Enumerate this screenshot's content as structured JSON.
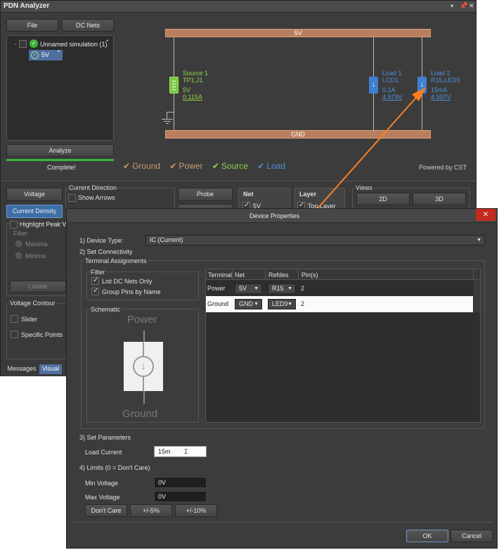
{
  "pdn": {
    "title": "PDN Analyzer",
    "file_btn": "File",
    "dcnets_btn": "DC Nets",
    "tree_root": "Unnamed simulation (1)",
    "tree_root_mark": "*",
    "tree_child": "5V",
    "tree_child_mark": "*",
    "analyze_btn": "Analyze",
    "status": "Complete!",
    "rail_top": "5V",
    "rail_bottom": "GND",
    "source": {
      "name": "Source 1",
      "ref": "TP1,J1",
      "voltage": "5V",
      "current": "0.115A"
    },
    "load1": {
      "name": "Load 1",
      "ref": "LCD1",
      "current": "0.1A",
      "voltage": "4.979V"
    },
    "load2": {
      "name": "Load 2",
      "ref": "R15,LED9",
      "current": "15mA",
      "voltage": "4.997V"
    },
    "legend": {
      "ground": "Ground",
      "power": "Power",
      "source": "Source",
      "load": "Load"
    },
    "powered_by": "Powered by CST",
    "voltage_btn": "Voltage",
    "current_density_btn": "Current Density",
    "current_direction_title": "Current Direction",
    "show_arrows": "Show Arrows",
    "probe_btn": "Probe",
    "net_title": "Net",
    "net_item": "5V",
    "layer_title": "Layer",
    "layer_item": "Top Layer",
    "views_title": "Views",
    "view_2d": "2D",
    "view_3d": "3D",
    "highlight_peak": "Highlight Peak V",
    "filter_title": "Filter",
    "maxima": "Maxima",
    "minima": "Minima",
    "locate_btn": "Locate",
    "voltage_contour_title": "Voltage Contour",
    "slider": "Slider",
    "specific_points": "Specific Points",
    "tab_messages": "Messages",
    "tab_visual": "Visual",
    "colors": {
      "power": "#c99a6e",
      "source": "#8fd34a",
      "load": "#4f8fd6"
    }
  },
  "dialog": {
    "title": "Device Properties",
    "close": "✕",
    "device_type_label": "1) Device Type:",
    "device_type_value": "IC (Current)",
    "set_connectivity": "2) Set Connectivity",
    "terminal_assignments": "Terminal Assignments",
    "filter_title": "Filter",
    "list_dc_nets": "List DC Nets Only",
    "group_pins": "Group Pins by Name",
    "schematic_title": "Schematic",
    "schem_power": "Power",
    "schem_ground": "Ground",
    "table": {
      "headers": [
        "Terminal",
        "Net",
        "Refdes",
        "Pin(s)"
      ],
      "rows": [
        {
          "terminal": "Power",
          "net": "5V",
          "refdes": "R15",
          "pins": "2"
        },
        {
          "terminal": "Ground",
          "net": "GND",
          "refdes": "LED9",
          "pins": "2"
        }
      ]
    },
    "set_parameters": "3) Set Parameters",
    "load_current_label": "Load Current",
    "load_current_value": "15m",
    "limits": "4) Limits (0 = Don't Care)",
    "min_voltage_label": "Min Voltage",
    "min_voltage_value": "0V",
    "max_voltage_label": "Max Voltage",
    "max_voltage_value": "0V",
    "dont_care_btn": "Don't Care",
    "pm5_btn": "+/-5%",
    "pm10_btn": "+/-10%",
    "ok_btn": "OK",
    "cancel_btn": "Cancel"
  }
}
